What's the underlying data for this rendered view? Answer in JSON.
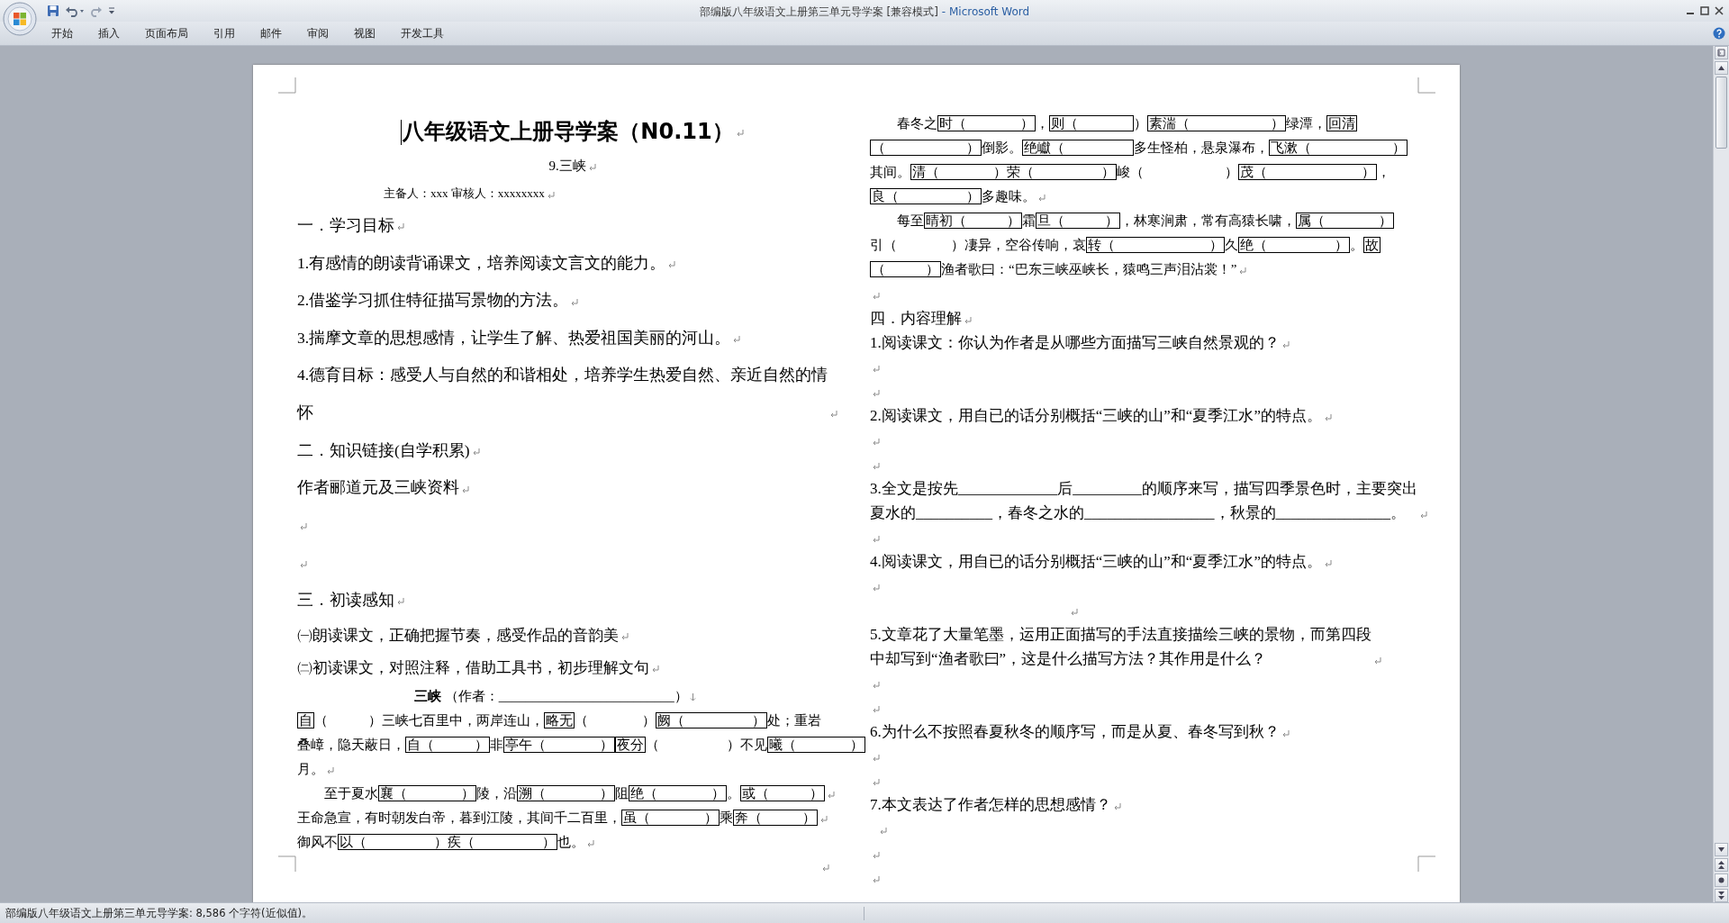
{
  "window": {
    "document_name": "部编版八年级语文上册第三单元导学案 [兼容模式]",
    "app_name": "- Microsoft Word"
  },
  "ribbon_tabs": [
    {
      "label": "开始",
      "selected": false
    },
    {
      "label": "插入",
      "selected": false
    },
    {
      "label": "页面布局",
      "selected": false
    },
    {
      "label": "引用",
      "selected": false
    },
    {
      "label": "邮件",
      "selected": false
    },
    {
      "label": "审阅",
      "selected": false
    },
    {
      "label": "视图",
      "selected": false
    },
    {
      "label": "开发工具",
      "selected": false
    }
  ],
  "document": {
    "columns": [
      [
        {
          "kind": "title",
          "lines": [
            "八年级语文上册导学案（N0.11）"
          ],
          "return_mark": true
        },
        {
          "kind": "subtitle",
          "lines": [
            "9.三峡"
          ],
          "return_mark": true
        },
        {
          "kind": "byline",
          "lines": [
            "主备人：xxx 审核人：xxxxxxxx"
          ],
          "return_mark": true
        },
        {
          "kind": "loose",
          "lines": [
            "一．学习目标"
          ],
          "return_mark": true
        },
        {
          "kind": "loose",
          "lines": [
            "1.有感情的朗读背诵课文，培养阅读文言文的能力。"
          ],
          "return_mark": true
        },
        {
          "kind": "loose",
          "lines": [
            "2.借鉴学习抓住特征描写景物的方法。"
          ],
          "return_mark": true
        },
        {
          "kind": "loose",
          "lines": [
            "3.揣摩文章的思想感情，让学生了解、热爱祖国美丽的河山。"
          ],
          "return_mark": true
        },
        {
          "kind": "loose",
          "lines": [
            "4.德育目标：感受人与自然的和谐相处，培养学生热爱自然、亲近自然的情",
            "怀"
          ],
          "return_mark": true
        },
        {
          "kind": "loose",
          "lines": [
            "二．知识链接(自学积累)"
          ],
          "return_mark": true
        },
        {
          "kind": "loose",
          "lines": [
            " 作者郦道元及三峡资料"
          ],
          "return_mark": true
        },
        {
          "kind": "loose",
          "return_mark": true
        },
        {
          "kind": "loose",
          "return_mark": true
        },
        {
          "kind": "loose",
          "lines": [
            "三．初读感知"
          ],
          "return_mark": true
        },
        {
          "kind": "mid",
          "lines": [
            "㈠朗读课文，正确把握节奏，感受作品的音韵美"
          ],
          "return_mark": true
        },
        {
          "kind": "mid",
          "lines": [
            "㈡初读课文，对照注释，借助工具书，初步理解文句"
          ],
          "return_mark": true
        },
        {
          "kind": "passage_title",
          "lines": [
            "**三峡** （作者：__________________________）"
          ],
          "line_break": true
        },
        {
          "kind": "passage",
          "lines": [
            [
              {
                "text": "自",
                "boxed": true
              },
              {
                "text": "（　　　）三峡七百里中，两岸连山，",
                "boxed": false
              },
              {
                "text": "略无",
                "boxed": true
              },
              {
                "text": "（　　　　）",
                "boxed": false
              },
              {
                "text": "阙（　　　　　）",
                "boxed": true
              },
              {
                "text": "处；重岩",
                "boxed": false
              }
            ],
            [
              {
                "text": "叠嶂，隐天蔽日，",
                "boxed": false
              },
              {
                "text": "自（　　　）",
                "boxed": true
              },
              {
                "text": "非",
                "boxed": false
              },
              {
                "text": "亭午（　　　　）",
                "boxed": true
              },
              {
                "text": "夜分",
                "boxed": true
              },
              {
                "text": "（　　　　　）不见",
                "boxed": false
              },
              {
                "text": "曦（　　　　）",
                "boxed": true
              }
            ],
            [
              {
                "text": "月。",
                "boxed": false
              }
            ]
          ],
          "return_mark": true
        },
        {
          "kind": "passage",
          "lines": [
            [
              {
                "text": "　　至于夏水",
                "boxed": false
              },
              {
                "text": "襄（　　　　）",
                "boxed": true
              },
              {
                "text": "陵，沿",
                "boxed": false
              },
              {
                "text": "溯（　　　　）",
                "boxed": true
              },
              {
                "text": "阻",
                "boxed": false
              },
              {
                "text": "绝（　　　　）",
                "boxed": true
              },
              {
                "text": "。",
                "boxed": false
              },
              {
                "text": "或（　　　）",
                "boxed": true
              }
            ]
          ],
          "return_mark": true
        },
        {
          "kind": "passage",
          "lines": [
            [
              {
                "text": "王命急宣，有时朝发白帝，暮到江陵，其间千二百里，",
                "boxed": false
              },
              {
                "text": "虽（　　　　）",
                "boxed": true
              },
              {
                "text": "乘",
                "boxed": false
              },
              {
                "text": "奔（　　　）",
                "boxed": true
              }
            ]
          ],
          "return_mark": true
        },
        {
          "kind": "passage",
          "lines": [
            [
              {
                "text": " 御风不",
                "boxed": false
              },
              {
                "text": "以（　　　　　）疾（　　　　　）",
                "boxed": true
              },
              {
                "text": "也。",
                "boxed": false
              }
            ]
          ],
          "return_mark": true
        },
        {
          "kind": "passage_end",
          "return_mark": true
        }
      ],
      [
        {
          "kind": "passage",
          "lines": [
            [
              {
                "text": "　　春冬之",
                "boxed": false
              },
              {
                "text": "时（　　　　）",
                "boxed": true
              },
              {
                "text": "，",
                "boxed": false
              },
              {
                "text": "则（　　　　",
                "boxed": true
              },
              {
                "text": "）",
                "boxed": false
              },
              {
                "text": "素湍（　　　　　　）",
                "boxed": true
              },
              {
                "text": "绿潭，",
                "boxed": false
              },
              {
                "text": "回清",
                "boxed": true
              }
            ],
            [
              {
                "text": "（　　　　　　）",
                "boxed": true
              },
              {
                "text": "倒影。",
                "boxed": false
              },
              {
                "text": "绝巘（　　　　　",
                "boxed": true
              },
              {
                "text": "多生怪柏，悬泉瀑布，",
                "boxed": false
              },
              {
                "text": "飞漱（　　　　　　）",
                "boxed": true
              }
            ],
            [
              {
                "text": "其间。",
                "boxed": false
              },
              {
                "text": "清（　　　　）荣（　　　　　）",
                "boxed": true
              },
              {
                "text": "峻（　　　　　　）",
                "boxed": false
              },
              {
                "text": "茂（　　　　　　　）",
                "boxed": true
              },
              {
                "text": "，",
                "boxed": false
              }
            ],
            [
              {
                "text": "良（　　　　　）",
                "boxed": true
              },
              {
                "text": "多趣味。",
                "boxed": false
              }
            ]
          ],
          "return_mark": true
        },
        {
          "kind": "passage",
          "lines": [
            [
              {
                "text": "　　每至",
                "boxed": false
              },
              {
                "text": "晴初（　　　）",
                "boxed": true
              },
              {
                "text": "霜",
                "boxed": false
              },
              {
                "text": "旦（　　　）",
                "boxed": true
              },
              {
                "text": "，林寒涧肃，常有高猿长啸，",
                "boxed": false
              },
              {
                "text": "属（　　　　）",
                "boxed": true
              }
            ],
            [
              {
                "text": "引（　　　　）凄异，空谷传响，哀",
                "boxed": false
              },
              {
                "text": "转（　　　　　　　）",
                "boxed": true
              },
              {
                "text": "久",
                "boxed": false
              },
              {
                "text": "绝（　　　　　）",
                "boxed": true
              },
              {
                "text": "。",
                "boxed": false
              },
              {
                "text": "故",
                "boxed": true
              }
            ],
            [
              {
                "text": "（　　　）",
                "boxed": true
              },
              {
                "text": "渔者歌曰：“巴东三峡巫峡长，猿鸣三声泪沾裳！”",
                "boxed": false
              }
            ]
          ],
          "return_mark": true
        },
        {
          "kind": "tight",
          "return_mark": true
        },
        {
          "kind": "tight",
          "lines": [
            "四．内容理解"
          ],
          "return_mark": true
        },
        {
          "kind": "tight",
          "lines": [
            "1.阅读课文：你认为作者是从哪些方面描写三峡自然景观的？"
          ],
          "return_mark": true
        },
        {
          "kind": "tight",
          "return_mark": true
        },
        {
          "kind": "tight",
          "return_mark": true
        },
        {
          "kind": "tight",
          "lines": [
            "2.阅读课文，用自已的话分别概括“三峡的山”和“夏季江水”的特点。"
          ],
          "return_mark": true
        },
        {
          "kind": "tight",
          "return_mark": true
        },
        {
          "kind": "tight",
          "return_mark": true
        },
        {
          "kind": "tight",
          "lines": [
            "3.全文是按先_____________后_________的顺序来写，描写四季景色时，主要突出",
            "夏水的__________，春冬之水的_________________，秋景的_______________。"
          ],
          "return_mark": true
        },
        {
          "kind": "tight",
          "return_mark": true
        },
        {
          "kind": "tight",
          "lines": [
            "4.阅读课文，用自已的话分别概括“三峡的山”和“夏季江水”的特点。"
          ],
          "return_mark": true
        },
        {
          "kind": "tight",
          "return_mark": true
        },
        {
          "kind": "tight_center",
          "return_mark": true
        },
        {
          "kind": "tight",
          "lines": [
            "5.文章花了大量笔墨，运用正面描写的手法直接描绘三峡的景物，而第四段",
            "中却写到“渔者歌曰”，这是什么描写方法？其作用是什么？"
          ],
          "return_mark": true
        },
        {
          "kind": "tight",
          "return_mark": true
        },
        {
          "kind": "tight",
          "return_mark": true
        },
        {
          "kind": "tight",
          "lines": [
            "6.为什么不按照春夏秋冬的顺序写，而是从夏、春冬写到秋？"
          ],
          "return_mark": true
        },
        {
          "kind": "tight",
          "return_mark": true
        },
        {
          "kind": "tight",
          "return_mark": true
        },
        {
          "kind": "tight",
          "lines": [
            "7.本文表达了作者怎样的思想感情？"
          ],
          "return_mark": true
        },
        {
          "kind": "tight_indent",
          "return_mark": true
        },
        {
          "kind": "tight",
          "return_mark": true
        },
        {
          "kind": "tight",
          "return_mark": true
        }
      ]
    ]
  },
  "status_bar": {
    "text": "部编版八年级语文上册第三单元导学案: 8,586 个字符(近似值)。"
  }
}
